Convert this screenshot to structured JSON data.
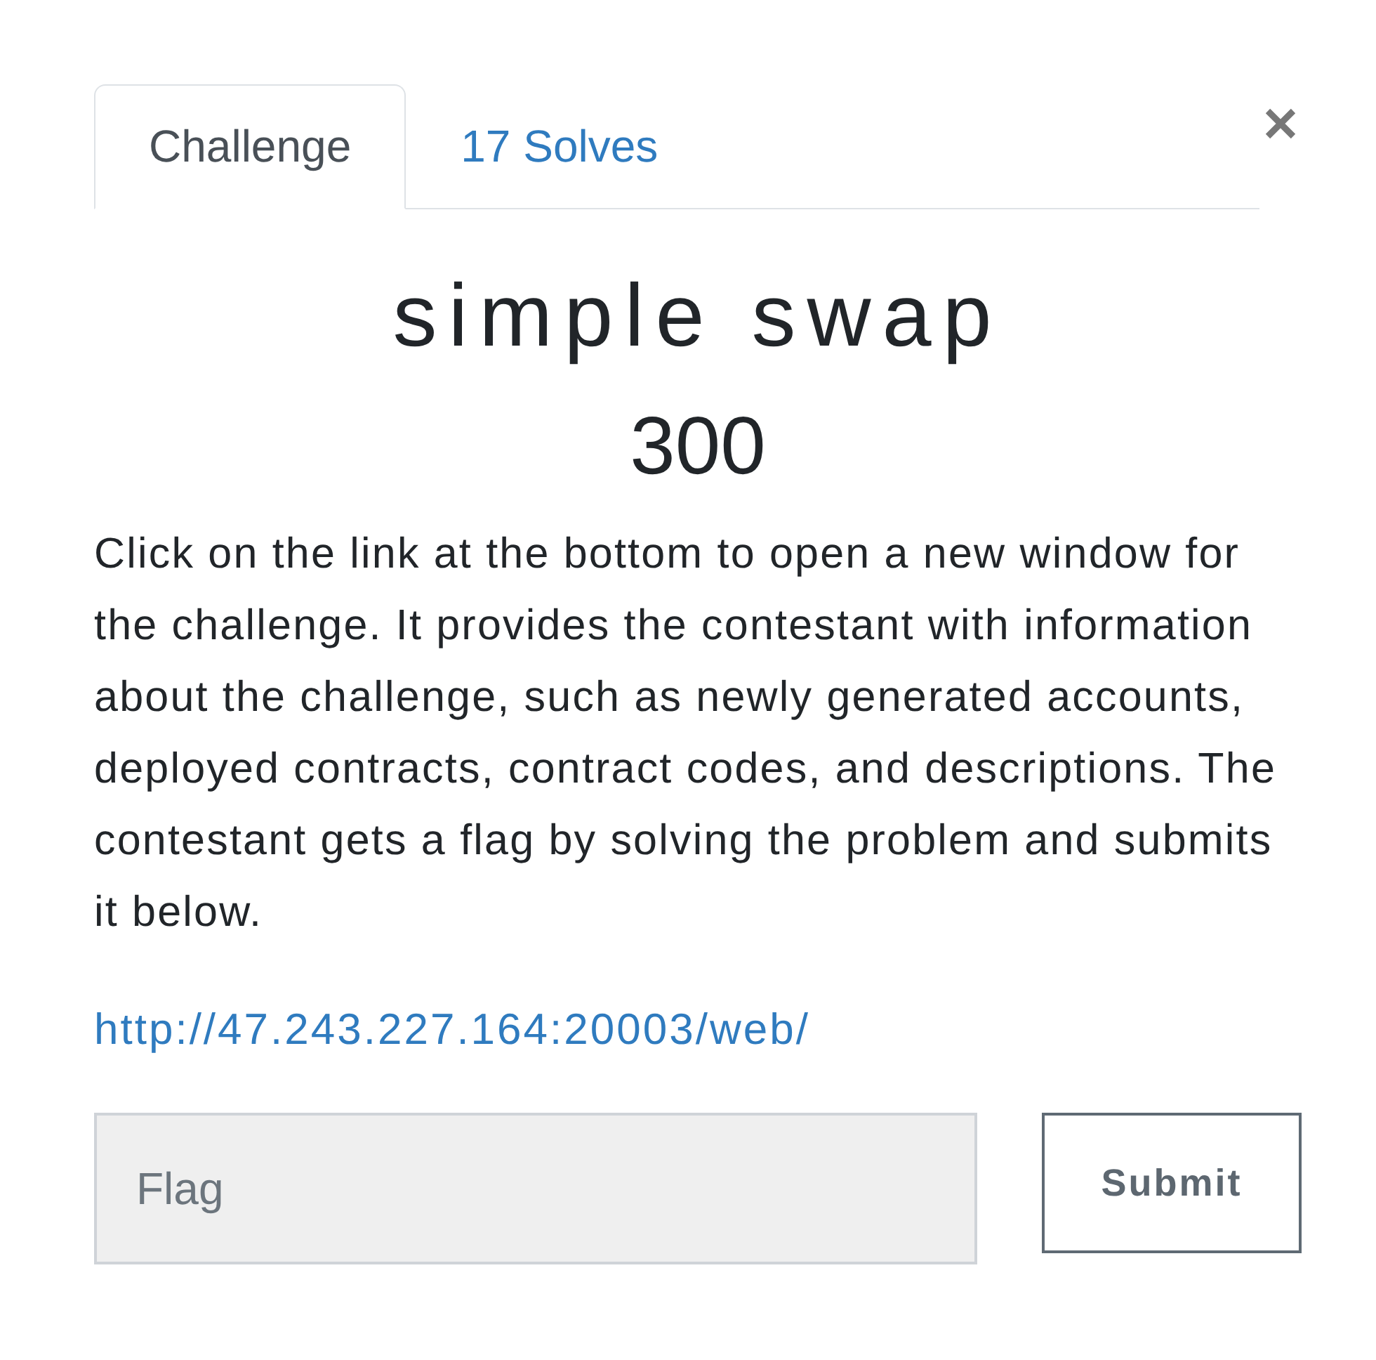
{
  "tabs": [
    {
      "label": "Challenge",
      "selected": true
    },
    {
      "label": "17 Solves",
      "selected": false
    }
  ],
  "challenge": {
    "title": "simple swap",
    "points": "300",
    "description": "Click on the link at the bottom to open a new window for the challenge. It provides the contestant with information about the challenge, such as newly generated accounts, deployed contracts, contract codes, and descriptions. The contestant gets a flag by solving the problem and submits it below.",
    "link": "http://47.243.227.164:20003/web/"
  },
  "flag_form": {
    "placeholder": "Flag",
    "submit": "Submit"
  }
}
